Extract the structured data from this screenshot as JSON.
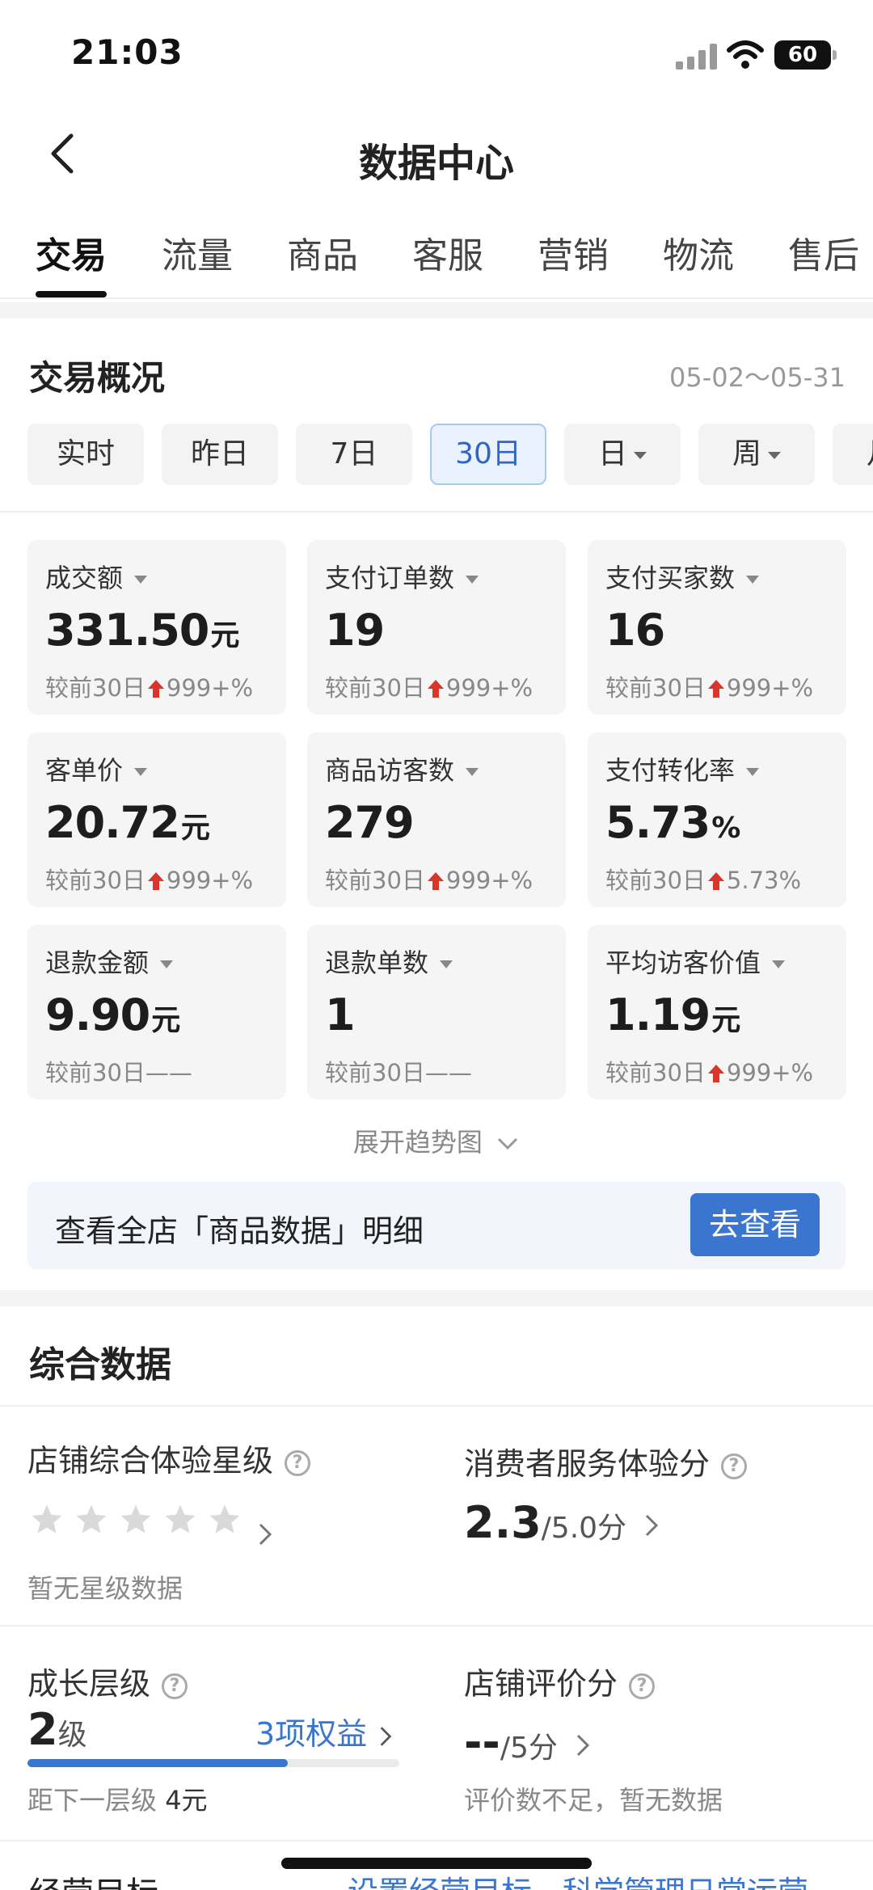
{
  "status_bar": {
    "time": "21:03",
    "battery": "60"
  },
  "header": {
    "title": "数据中心"
  },
  "tabs": [
    {
      "label": "交易",
      "active": true
    },
    {
      "label": "流量",
      "active": false
    },
    {
      "label": "商品",
      "active": false
    },
    {
      "label": "客服",
      "active": false
    },
    {
      "label": "营销",
      "active": false
    },
    {
      "label": "物流",
      "active": false
    },
    {
      "label": "售后",
      "active": false
    }
  ],
  "overview": {
    "title": "交易概况",
    "date_range": "05-02～05-31",
    "filters": [
      {
        "label": "实时",
        "active": false
      },
      {
        "label": "昨日",
        "active": false
      },
      {
        "label": "7日",
        "active": false
      },
      {
        "label": "30日",
        "active": true
      },
      {
        "label": "日",
        "active": false,
        "dropdown": true
      },
      {
        "label": "周",
        "active": false,
        "dropdown": true
      },
      {
        "label": "月",
        "active": false,
        "dropdown": true
      }
    ],
    "metrics": [
      {
        "label": "成交额",
        "value": "331.50",
        "unit": "元",
        "compare_prefix": "较前30日",
        "change": "999+%",
        "trend": "up"
      },
      {
        "label": "支付订单数",
        "value": "19",
        "unit": "",
        "compare_prefix": "较前30日",
        "change": "999+%",
        "trend": "up"
      },
      {
        "label": "支付买家数",
        "value": "16",
        "unit": "",
        "compare_prefix": "较前30日",
        "change": "999+%",
        "trend": "up"
      },
      {
        "label": "客单价",
        "value": "20.72",
        "unit": "元",
        "compare_prefix": "较前30日",
        "change": "999+%",
        "trend": "up"
      },
      {
        "label": "商品访客数",
        "value": "279",
        "unit": "",
        "compare_prefix": "较前30日",
        "change": "999+%",
        "trend": "up"
      },
      {
        "label": "支付转化率",
        "value": "5.73",
        "unit": "%",
        "compare_prefix": "较前30日",
        "change": "5.73%",
        "trend": "up"
      },
      {
        "label": "退款金额",
        "value": "9.90",
        "unit": "元",
        "compare_prefix": "较前30日",
        "change": "——",
        "trend": "none"
      },
      {
        "label": "退款单数",
        "value": "1",
        "unit": "",
        "compare_prefix": "较前30日",
        "change": "——",
        "trend": "none"
      },
      {
        "label": "平均访客价值",
        "value": "1.19",
        "unit": "元",
        "compare_prefix": "较前30日",
        "change": "999+%",
        "trend": "up"
      }
    ],
    "expand_label": "展开趋势图",
    "banner_text": "查看全店「商品数据」明细",
    "banner_button": "去查看"
  },
  "comprehensive": {
    "title": "综合数据",
    "store_rating": {
      "label": "店铺综合体验星级",
      "stars": 0,
      "note": "暂无星级数据"
    },
    "service_score": {
      "label": "消费者服务体验分",
      "score": "2.3",
      "suffix": "/5.0分"
    },
    "growth_level": {
      "label": "成长层级",
      "level": "2",
      "level_unit": "级",
      "benefits": "3项权益",
      "progress": 0.7,
      "next_prefix": "距下一层级",
      "next_value": "4元"
    },
    "review_score": {
      "label": "店铺评价分",
      "score": "--",
      "suffix": "/5分",
      "note": "评价数不足，暂无数据"
    }
  },
  "footer": {
    "label": "经营目标",
    "link": "设置经营目标，科学管理日常运营"
  },
  "colors": {
    "accent": "#3a76cf",
    "up_arrow": "#d9362b",
    "card_bg": "#f5f5f5"
  }
}
